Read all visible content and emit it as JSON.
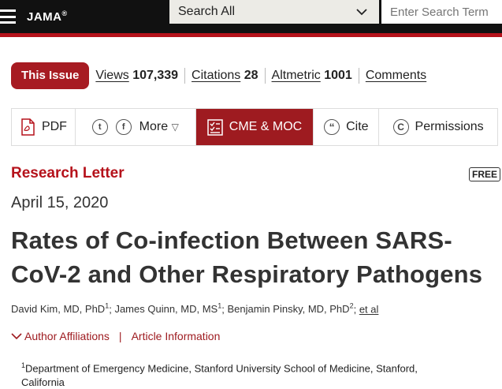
{
  "header": {
    "logo": "JAMA",
    "logo_mark": "®",
    "search_scope": "Search All",
    "search_placeholder": "Enter Search Term"
  },
  "issue_bar": {
    "this_issue": "This Issue",
    "views_label": "Views",
    "views_value": "107,339",
    "citations_label": "Citations",
    "citations_value": "28",
    "altmetric_label": "Altmetric",
    "altmetric_value": "1001",
    "comments_label": "Comments"
  },
  "toolbar": {
    "pdf": "PDF",
    "more": "More",
    "cme": "CME & MOC",
    "cite": "Cite",
    "permissions": "Permissions"
  },
  "article": {
    "type": "Research Letter",
    "free_badge": "FREE",
    "date": "April 15, 2020",
    "title": "Rates of Co-infection Between SARS-CoV-2 and Other Respiratory Pathogens",
    "authors": [
      {
        "name": "David Kim, MD, PhD",
        "sup": "1"
      },
      {
        "name": "James Quinn, MD, MS",
        "sup": "1"
      },
      {
        "name": "Benjamin Pinsky, MD, PhD",
        "sup": "2"
      }
    ],
    "et_al": "et al",
    "author_affiliations": "Author Affiliations",
    "article_information": "Article Information",
    "affiliation_sup": "1",
    "affiliation_text": "Department of Emergency Medicine, Stanford University School of Medicine, Stanford, California"
  },
  "colors": {
    "brand_red": "#b5121b",
    "cme_bg": "#9e1b20",
    "header_bg": "#111111"
  }
}
